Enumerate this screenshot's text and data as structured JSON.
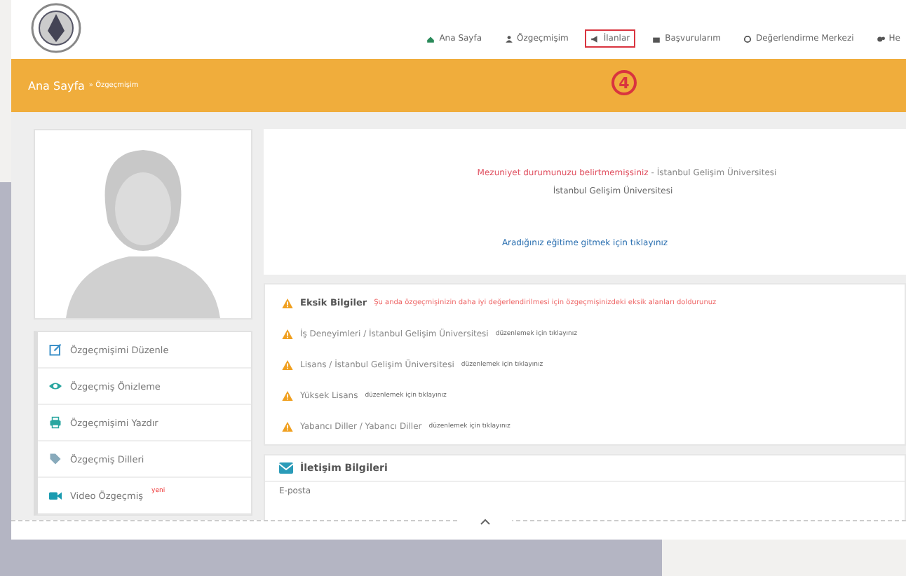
{
  "nav": {
    "items": [
      {
        "label": "Ana Sayfa",
        "selected": false
      },
      {
        "label": "Özgeçmişim",
        "selected": false
      },
      {
        "label": "İlanlar",
        "selected": true
      },
      {
        "label": "Başvurularım",
        "selected": false
      },
      {
        "label": "Değerlendirme Merkezi",
        "selected": false
      },
      {
        "label": "He",
        "selected": false
      }
    ]
  },
  "annotation": {
    "number": "4"
  },
  "banner": {
    "title": "Ana Sayfa",
    "crumb": "» Özgeçmişim"
  },
  "profile": {
    "status": "Mezuniyet durumunuzu belirtmemişsiniz",
    "separator": "-",
    "school": "İstanbul Gelişim Üniversitesi",
    "school_line": "İstanbul Gelişim Üniversitesi",
    "link": "Aradığınız eğitime gitmek için tıklayınız"
  },
  "sidebar": {
    "items": [
      {
        "label": "Özgeçmişimi Düzenle"
      },
      {
        "label": "Özgeçmiş Önizleme"
      },
      {
        "label": "Özgeçmişimi Yazdır"
      },
      {
        "label": "Özgeçmiş Dilleri"
      },
      {
        "label": "Video Özgeçmiş",
        "badge": "yeni"
      }
    ]
  },
  "missing": {
    "title": "Eksik Bilgiler",
    "note": "Şu anda özgeçmişinizin daha iyi değerlendirilmesi için özgeçmişinizdeki eksik alanları doldurunuz",
    "items": [
      {
        "label": "İş Deneyimleri / İstanbul Gelişim Üniversitesi",
        "action": "düzenlemek için tıklayınız"
      },
      {
        "label": "Lisans / İstanbul Gelişim Üniversitesi",
        "action": "düzenlemek için tıklayınız"
      },
      {
        "label": "Yüksek Lisans",
        "action": "düzenlemek için tıklayınız"
      },
      {
        "label": "Yabancı Diller / Yabancı Diller",
        "action": "düzenlemek için tıklayınız"
      }
    ]
  },
  "contact": {
    "title": "İletişim Bilgileri",
    "field": "E-posta"
  }
}
